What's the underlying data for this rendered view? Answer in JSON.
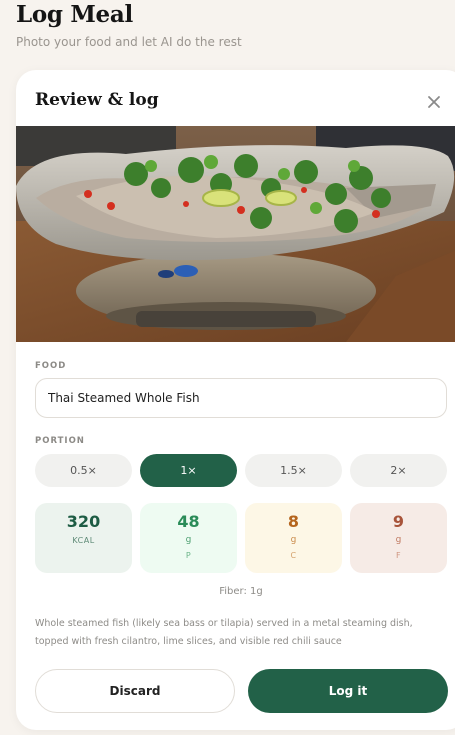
{
  "header": {
    "title": "Log Meal",
    "subtitle": "Photo your food and let AI do the rest"
  },
  "card": {
    "title": "Review & log",
    "close_icon": "close-icon",
    "photo_alt_icon": "food-photo",
    "food": {
      "label": "FOOD",
      "value": "Thai Steamed Whole Fish"
    },
    "portion": {
      "label": "PORTION",
      "options": [
        "0.5×",
        "1×",
        "1.5×",
        "2×"
      ],
      "selected": "1×"
    },
    "macros": {
      "kcal": {
        "value": "320",
        "unit": "KCAL",
        "color": "#1e5c44",
        "bg": "#ecf3ee"
      },
      "protein": {
        "value": "48",
        "unit": "g",
        "key": "P",
        "color": "#2a8b58",
        "bg": "#eefbf2"
      },
      "carbs": {
        "value": "8",
        "unit": "g",
        "key": "C",
        "color": "#b5651d",
        "bg": "#fdf7e6"
      },
      "fat": {
        "value": "9",
        "unit": "g",
        "key": "F",
        "color": "#a8543a",
        "bg": "#f6ebe6"
      }
    },
    "fiber": "Fiber: 1g",
    "description": "Whole steamed fish (likely sea bass or tilapia) served in a metal steaming dish, topped with fresh cilantro, lime slices, and visible red chili sauce",
    "actions": {
      "discard": "Discard",
      "log": "Log it"
    }
  },
  "colors": {
    "accent": "#226148",
    "background": "#f7f3ee"
  }
}
